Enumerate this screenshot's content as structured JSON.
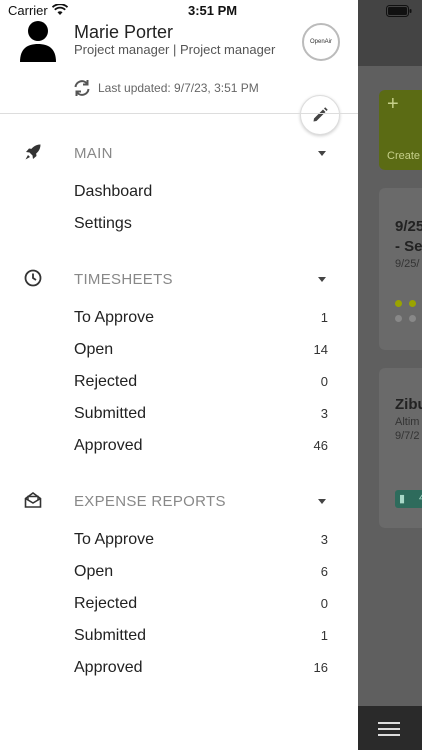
{
  "status_bar": {
    "carrier": "Carrier",
    "time": "3:51 PM"
  },
  "header": {
    "user_name": "Marie Porter",
    "user_role": "Project manager | Project manager",
    "logo_text": "OpenAir",
    "last_updated": "Last updated: 9/7/23, 3:51 PM"
  },
  "sections": {
    "main": {
      "label": "MAIN",
      "items": [
        {
          "label": "Dashboard"
        },
        {
          "label": "Settings"
        }
      ]
    },
    "timesheets": {
      "label": "TIMESHEETS",
      "items": [
        {
          "label": "To Approve",
          "count": "1"
        },
        {
          "label": "Open",
          "count": "14"
        },
        {
          "label": "Rejected",
          "count": "0"
        },
        {
          "label": "Submitted",
          "count": "3"
        },
        {
          "label": "Approved",
          "count": "46"
        }
      ]
    },
    "expense_reports": {
      "label": "EXPENSE REPORTS",
      "items": [
        {
          "label": "To Approve",
          "count": "3"
        },
        {
          "label": "Open",
          "count": "6"
        },
        {
          "label": "Rejected",
          "count": "0"
        },
        {
          "label": "Submitted",
          "count": "1"
        },
        {
          "label": "Approved",
          "count": "16"
        }
      ]
    }
  },
  "background": {
    "create_label": "Create",
    "card1_title": "9/25",
    "card1_title2": "- Se",
    "card1_sub": "9/25/",
    "card2_title": "Zibu",
    "card2_sub1": "Altim",
    "card2_sub2": "9/7/2",
    "card2_tag": "4"
  },
  "colors": {
    "accent_green": "#5b6b14",
    "tag_teal": "#2e6b5c"
  }
}
